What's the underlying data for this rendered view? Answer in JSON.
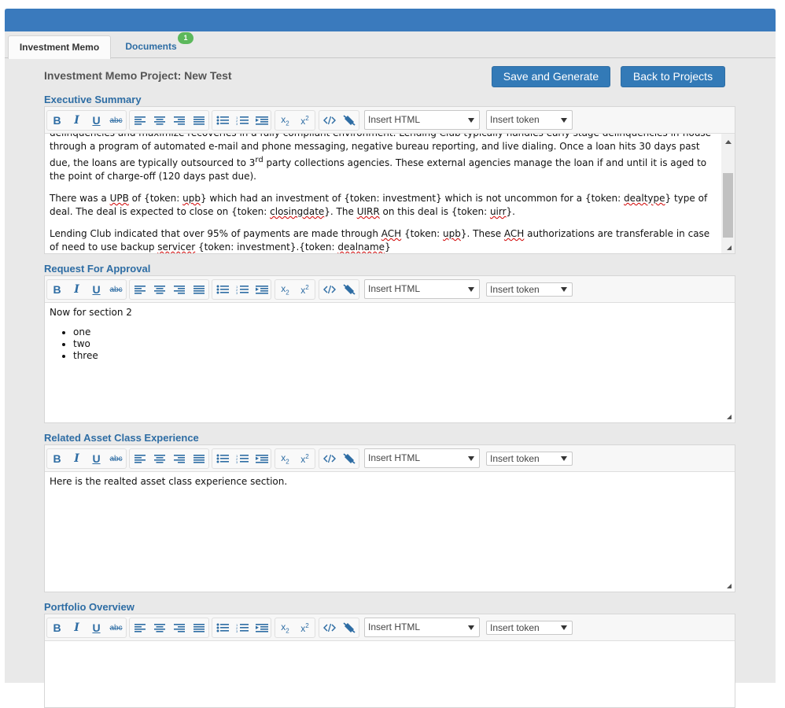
{
  "tabs": [
    {
      "label": "Investment Memo",
      "active": true
    },
    {
      "label": "Documents",
      "badge": "1"
    }
  ],
  "project_title": "Investment Memo Project: New Test",
  "buttons": {
    "save": "Save and Generate",
    "back": "Back to Projects"
  },
  "toolbar": {
    "bold": "B",
    "italic": "I",
    "underline": "U",
    "strike": "abc",
    "insert_html": "Insert HTML",
    "insert_token": "Insert token",
    "icons": [
      "bold-icon",
      "italic-icon",
      "underline-icon",
      "strikethrough-icon",
      "align-left-icon",
      "align-center-icon",
      "align-right-icon",
      "align-justify-icon",
      "bullet-list-icon",
      "numbered-list-icon",
      "indent-icon",
      "subscript-icon",
      "superscript-icon",
      "view-html-icon",
      "clear-format-icon"
    ]
  },
  "sections": [
    {
      "title": "Executive Summary",
      "content": {
        "top_line": "delinquencies and maximize recoveries in a fully compliant environment. Lending Club typically handles early stage delinquencies in-house",
        "p1": {
          "a": "through a program of automated e-mail and phone messaging, negative bureau reporting, and live dialing. Once a loan hits 30 days past due, the loans are typically outsourced to 3",
          "sup": "rd",
          "b": " party collections agencies. These external agencies manage the loan if and until it is aged to the point of charge-off (120 days past due)."
        },
        "p2": {
          "t1": "There was a ",
          "t2": "UPB",
          "t3": " of {token: ",
          "t4": "upb",
          "t5": "} which had an investment of {token: investment} which is not uncommon for a {token: ",
          "t6": "dealtype",
          "t7": "} type of deal. The deal is expected to close on {token: ",
          "t8": "closingdate",
          "t9": "}. The ",
          "t10": "UIRR",
          "t11": " on this deal is {token: ",
          "t12": "uirr",
          "t13": "}."
        },
        "p3": {
          "t1": "Lending Club indicated that over 95% of payments are made through ",
          "t2": "ACH",
          "t3": " {token: ",
          "t4": "upb",
          "t5": "}. These ",
          "t6": "ACH",
          "t7": " authorizations are transferable in case of need to use backup ",
          "t8": "servicer",
          "t9": " {token: investment}.{token: ",
          "t10": "dealname",
          "t11": "}"
        }
      }
    },
    {
      "title": "Request For Approval",
      "content": {
        "p1": "Now for section 2",
        "list": [
          "one",
          "two",
          "three"
        ]
      }
    },
    {
      "title": "Related Asset Class Experience",
      "content": {
        "p1": "Here is the realted asset class experience section."
      }
    },
    {
      "title": "Portfolio Overview",
      "content": {
        "p1": ""
      }
    }
  ],
  "colors": {
    "topbar": "#3a7abd",
    "button": "#337ab7",
    "section_title": "#2e6da4",
    "badge": "#5cb85c"
  }
}
